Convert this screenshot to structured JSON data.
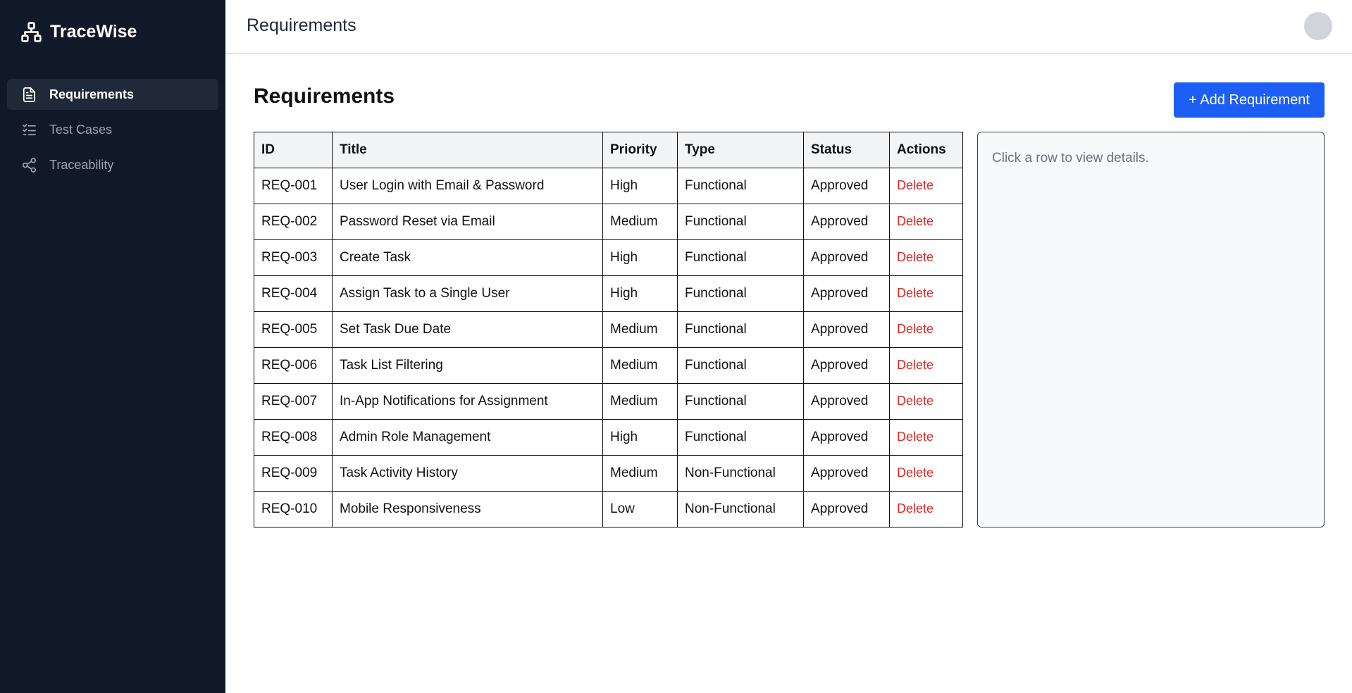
{
  "app": {
    "name": "TraceWise"
  },
  "sidebar": {
    "items": [
      {
        "label": "Requirements",
        "icon": "document-icon",
        "active": true
      },
      {
        "label": "Test Cases",
        "icon": "checklist-icon",
        "active": false
      },
      {
        "label": "Traceability",
        "icon": "share-nodes-icon",
        "active": false
      }
    ]
  },
  "header": {
    "title": "Requirements"
  },
  "main": {
    "title": "Requirements",
    "add_button_label": "+ Add Requirement",
    "details_placeholder": "Click a row to view details."
  },
  "table": {
    "columns": [
      "ID",
      "Title",
      "Priority",
      "Type",
      "Status",
      "Actions"
    ],
    "action_label": "Delete",
    "rows": [
      {
        "id": "REQ-001",
        "title": "User Login with Email & Password",
        "priority": "High",
        "type": "Functional",
        "status": "Approved"
      },
      {
        "id": "REQ-002",
        "title": "Password Reset via Email",
        "priority": "Medium",
        "type": "Functional",
        "status": "Approved"
      },
      {
        "id": "REQ-003",
        "title": "Create Task",
        "priority": "High",
        "type": "Functional",
        "status": "Approved"
      },
      {
        "id": "REQ-004",
        "title": "Assign Task to a Single User",
        "priority": "High",
        "type": "Functional",
        "status": "Approved"
      },
      {
        "id": "REQ-005",
        "title": "Set Task Due Date",
        "priority": "Medium",
        "type": "Functional",
        "status": "Approved"
      },
      {
        "id": "REQ-006",
        "title": "Task List Filtering",
        "priority": "Medium",
        "type": "Functional",
        "status": "Approved"
      },
      {
        "id": "REQ-007",
        "title": "In-App Notifications for Assignment",
        "priority": "Medium",
        "type": "Functional",
        "status": "Approved"
      },
      {
        "id": "REQ-008",
        "title": "Admin Role Management",
        "priority": "High",
        "type": "Functional",
        "status": "Approved"
      },
      {
        "id": "REQ-009",
        "title": "Task Activity History",
        "priority": "Medium",
        "type": "Non-Functional",
        "status": "Approved"
      },
      {
        "id": "REQ-010",
        "title": "Mobile Responsiveness",
        "priority": "Low",
        "type": "Non-Functional",
        "status": "Approved"
      }
    ]
  },
  "colors": {
    "sidebar_bg": "#111827",
    "sidebar_active_bg": "#1f2937",
    "accent": "#1d5ff5",
    "danger": "#dc2626"
  }
}
